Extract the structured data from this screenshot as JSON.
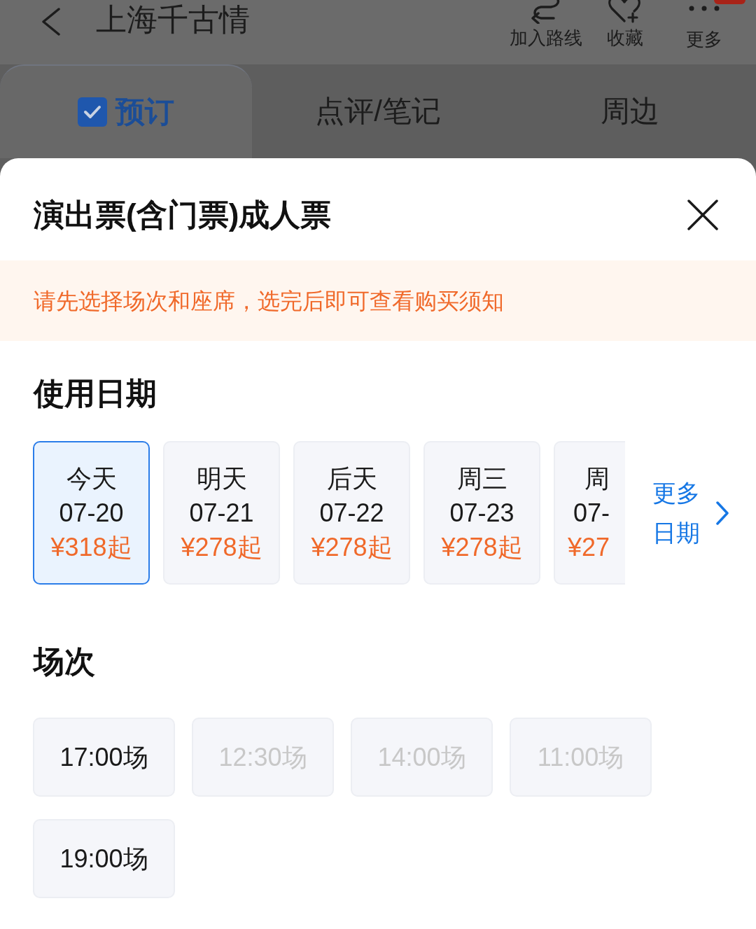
{
  "header": {
    "title": "上海千古情",
    "actions": [
      {
        "kind": "route",
        "label": "加入路线"
      },
      {
        "kind": "favorite",
        "label": "收藏"
      },
      {
        "kind": "more",
        "label": "更多"
      }
    ]
  },
  "tabs": [
    {
      "label": "预订",
      "selected": true
    },
    {
      "label": "点评/笔记",
      "selected": false
    },
    {
      "label": "周边",
      "selected": false
    }
  ],
  "sheet": {
    "title": "演出票(含门票)成人票",
    "notice": "请先选择场次和座席，选完后即可查看购买须知",
    "dates": {
      "heading": "使用日期",
      "items": [
        {
          "day": "今天",
          "date": "07-20",
          "price": "¥318起",
          "selected": true
        },
        {
          "day": "明天",
          "date": "07-21",
          "price": "¥278起",
          "selected": false
        },
        {
          "day": "后天",
          "date": "07-22",
          "price": "¥278起",
          "selected": false
        },
        {
          "day": "周三",
          "date": "07-23",
          "price": "¥278起",
          "selected": false
        },
        {
          "day": "周",
          "date": "07-",
          "price": "¥27",
          "selected": false
        }
      ],
      "more": "更多日期"
    },
    "sessions": {
      "heading": "场次",
      "items": [
        {
          "label": "17:00场",
          "disabled": false
        },
        {
          "label": "12:30场",
          "disabled": true
        },
        {
          "label": "14:00场",
          "disabled": true
        },
        {
          "label": "11:00场",
          "disabled": true
        },
        {
          "label": "19:00场",
          "disabled": false
        }
      ]
    }
  }
}
